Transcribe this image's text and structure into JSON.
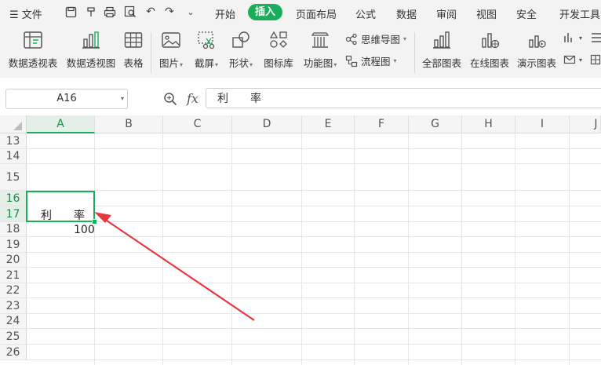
{
  "menu": {
    "file": "文件",
    "tabs": [
      "开始",
      "插入",
      "页面布局",
      "公式",
      "数据",
      "审阅",
      "视图",
      "安全",
      "开发工具"
    ],
    "active_tab": "插入"
  },
  "ribbon": {
    "pivot_table": "数据透视表",
    "pivot_chart": "数据透视图",
    "table": "表格",
    "picture": "图片",
    "screenshot": "截屏",
    "shape": "形状",
    "icon_library": "图标库",
    "function_chart": "功能图",
    "mind_map": "思维导图",
    "flow_chart": "流程图",
    "all_charts": "全部图表",
    "online_charts": "在线图表",
    "demo_charts": "演示图表"
  },
  "formula_bar": {
    "name_box": "A16",
    "fx": "fx",
    "content": "利　　率"
  },
  "sheet": {
    "columns": [
      "A",
      "B",
      "C",
      "D",
      "E",
      "F",
      "G",
      "H",
      "I",
      "J"
    ],
    "active_column": "A",
    "rows": [
      "13",
      "14",
      "15",
      "16",
      "17",
      "18",
      "19",
      "20",
      "21",
      "22",
      "23",
      "24",
      "25",
      "26"
    ],
    "active_rows": [
      "16",
      "17"
    ],
    "cell_a16": "利　　率",
    "cell_a18": "100"
  },
  "colors": {
    "accent": "#1aae5b",
    "arrow": "#e8383d"
  }
}
